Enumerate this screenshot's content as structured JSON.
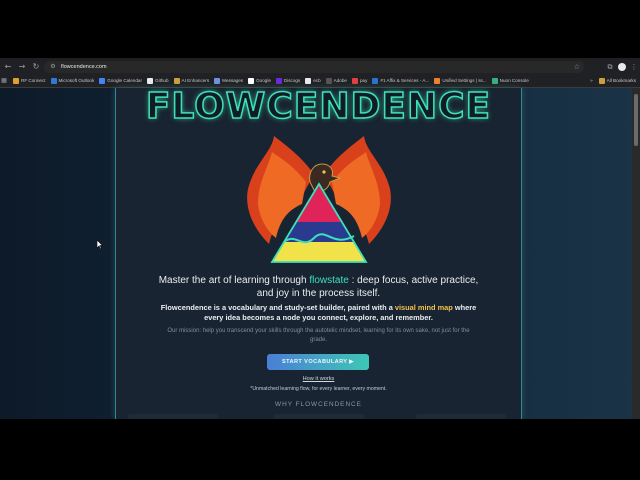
{
  "browser": {
    "url": "flowcendence.com",
    "bookmarks": [
      {
        "label": "RF Connect",
        "color": "#e0a030"
      },
      {
        "label": "Microsoft Outlook",
        "color": "#2f7ad8"
      },
      {
        "label": "Google Calendar",
        "color": "#4285f4"
      },
      {
        "label": "Github",
        "color": "#e8eaed"
      },
      {
        "label": "AI Enhancers",
        "color": "#c8a040"
      },
      {
        "label": "Messages",
        "color": "#7090e0"
      },
      {
        "label": "Google",
        "color": "#ffffff"
      },
      {
        "label": "Discogs",
        "color": "#6a2bd9"
      },
      {
        "label": "ecb",
        "color": "#e8eaed"
      },
      {
        "label": "Adobe",
        "color": "#555555"
      },
      {
        "label": "pay",
        "color": "#e04040"
      },
      {
        "label": "#1 Affix & Services - A...",
        "color": "#3070d0"
      },
      {
        "label": "Unified Settings | ss...",
        "color": "#f08030"
      },
      {
        "label": "Nuon Console",
        "color": "#38b080"
      }
    ],
    "overflow_label": "»",
    "all_bookmarks_label": "All Bookmarks"
  },
  "page": {
    "logo": "FLOWCENDENCE",
    "lead_1": "Master the art of learning through ",
    "lead_highlight": "flowstate",
    "lead_2": " : deep focus, active practice, and joy in the process itself.",
    "desc_1": "Flowcendence is a vocabulary and study-set builder, paired with a ",
    "desc_highlight": "visual mind map",
    "desc_2": " where every idea becomes a node you connect, explore, and remember.",
    "mission": "Our mission: help you transcend your skills through the autotelic mindset, learning for its own sake, not just for the grade.",
    "cta_label": "START VOCABULARY ▶",
    "how_link": "How it works",
    "note": "*Unmatched learning flow, for every learner, every moment.",
    "why_heading": "WHY FLOWCENDENCE"
  },
  "colors": {
    "accent_teal": "#3ee0b8",
    "accent_gold": "#f2c14e",
    "phoenix_red": "#e04a1f",
    "triangle_red": "#e0245a",
    "triangle_blue": "#2a3b8f",
    "triangle_yellow": "#f2e24a"
  }
}
